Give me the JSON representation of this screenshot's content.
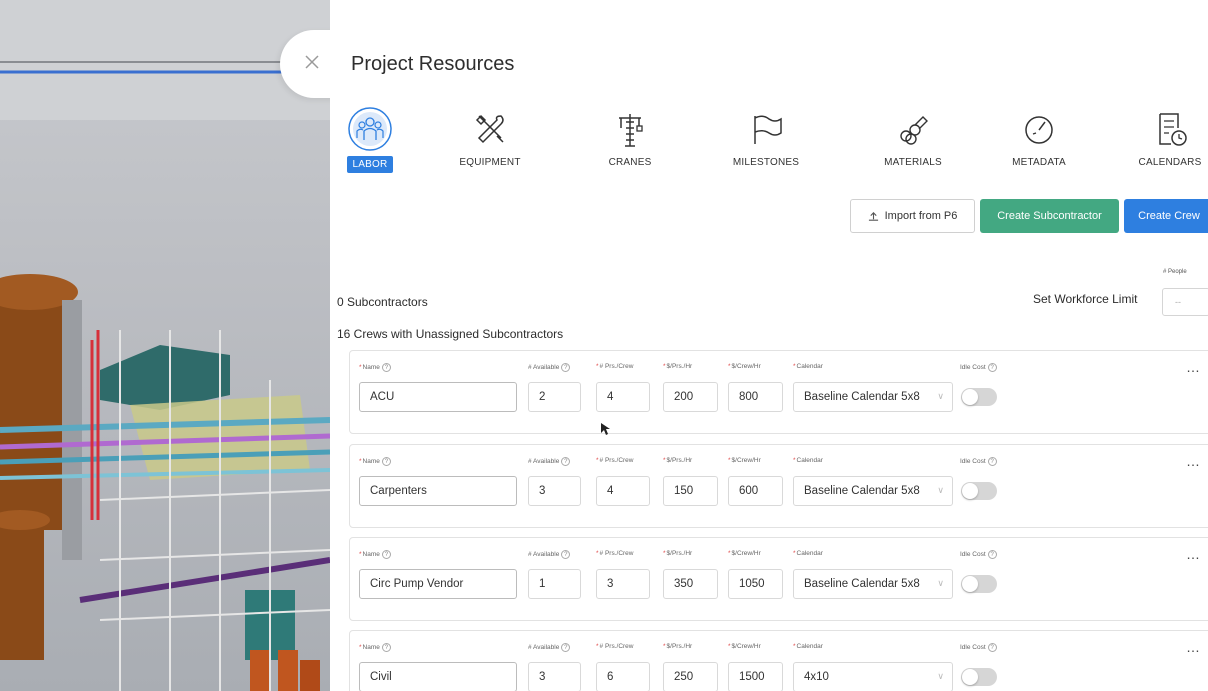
{
  "panel": {
    "title": "Project Resources",
    "categories": [
      {
        "label": "LABOR",
        "icon": "workers-icon",
        "active": true
      },
      {
        "label": "EQUIPMENT",
        "icon": "tools-icon",
        "active": false
      },
      {
        "label": "CRANES",
        "icon": "crane-icon",
        "active": false
      },
      {
        "label": "MILESTONES",
        "icon": "flag-icon",
        "active": false
      },
      {
        "label": "MATERIALS",
        "icon": "materials-icon",
        "active": false
      },
      {
        "label": "METADATA",
        "icon": "gauge-icon",
        "active": false
      },
      {
        "label": "CALENDARS",
        "icon": "calendar-icon",
        "active": false
      }
    ],
    "actions": {
      "import_label": "Import from P6",
      "create_sub_label": "Create Subcontractor",
      "create_crew_label": "Create Crew"
    },
    "subcontractors_count": "0 Subcontractors",
    "workforce": {
      "label": "Set Workforce Limit",
      "people_label": "# People",
      "placeholder": "--"
    },
    "crews_heading": "16 Crews with Unassigned Subcontractors",
    "field_labels": {
      "name": "Name",
      "available": "# Available",
      "prs_crew": "# Prs./Crew",
      "rate_prs": "$/Prs./Hr",
      "rate_crew": "$/Crew/Hr",
      "calendar": "Calendar",
      "idle_cost": "Idle Cost",
      "required_mark": "*",
      "help_mark": "?",
      "more": "…"
    },
    "crews": [
      {
        "name": "ACU",
        "available": "2",
        "prs_crew": "4",
        "rate_prs": "200",
        "rate_crew": "800",
        "calendar": "Baseline Calendar 5x8",
        "idle_cost": false
      },
      {
        "name": "Carpenters",
        "available": "3",
        "prs_crew": "4",
        "rate_prs": "150",
        "rate_crew": "600",
        "calendar": "Baseline Calendar 5x8",
        "idle_cost": false
      },
      {
        "name": "Circ Pump Vendor",
        "available": "1",
        "prs_crew": "3",
        "rate_prs": "350",
        "rate_crew": "1050",
        "calendar": "Baseline Calendar 5x8",
        "idle_cost": false
      },
      {
        "name": "Civil",
        "available": "3",
        "prs_crew": "6",
        "rate_prs": "250",
        "rate_crew": "1500",
        "calendar": "4x10",
        "idle_cost": false
      }
    ]
  },
  "colors": {
    "primary": "#2e7fe0",
    "success": "#43a882"
  }
}
